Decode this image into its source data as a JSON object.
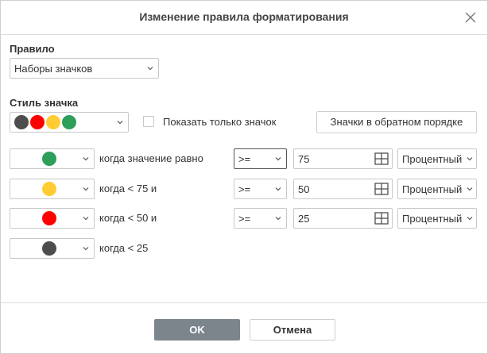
{
  "dialog": {
    "title": "Изменение правила форматирования"
  },
  "rule": {
    "label": "Правило",
    "selected": "Наборы значков"
  },
  "icon_style": {
    "label": "Стиль значка",
    "colors": [
      "#4d4d4d",
      "#ff0000",
      "#ffcc33",
      "#2e9e5b"
    ],
    "show_icon_only_label": "Показать только значок",
    "show_icon_only_checked": false,
    "reverse_button_label": "Значки в обратном порядке"
  },
  "rows": [
    {
      "icon_color": "#2e9e5b",
      "condition": "когда значение равно",
      "operator": ">=",
      "value": "75",
      "type": "Процентный"
    },
    {
      "icon_color": "#ffcc33",
      "condition": "когда < 75 и",
      "operator": ">=",
      "value": "50",
      "type": "Процентный"
    },
    {
      "icon_color": "#ff0000",
      "condition": "когда < 50 и",
      "operator": ">=",
      "value": "25",
      "type": "Процентный"
    },
    {
      "icon_color": "#4d4d4d",
      "condition": "когда < 25"
    }
  ],
  "footer": {
    "ok_label": "OK",
    "cancel_label": "Отмена"
  }
}
